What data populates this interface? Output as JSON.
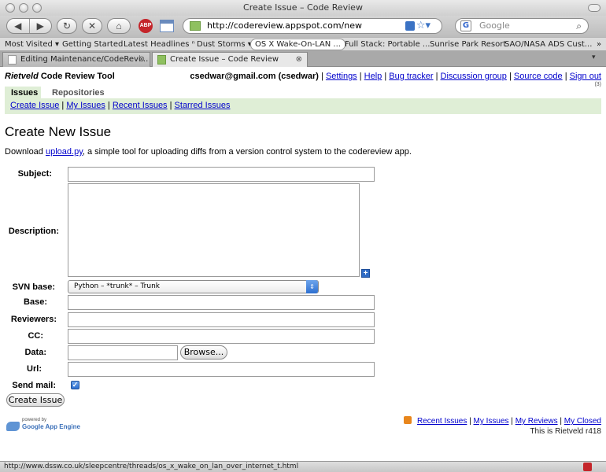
{
  "window": {
    "title": "Create Issue – Code Review"
  },
  "toolbar": {
    "url": "http://codereview.appspot.com/new",
    "search_placeholder": "Google"
  },
  "bookmarks": [
    "Most Visited ▾",
    "Getting Started",
    "Latest Headlines ⁿ",
    "Dust Storms ▾",
    "OS X Wake-On-LAN ...",
    "Full Stack: Portable ...",
    "Sunrise Park Resort",
    "SAO/NASA ADS Cust...",
    "»"
  ],
  "tabs": [
    {
      "label": "Editing Maintenance/CodeRevi..."
    },
    {
      "label": "Create Issue – Code Review"
    }
  ],
  "header": {
    "brand_italic": "Rietveld",
    "brand_rest": " Code Review Tool",
    "user": "csedwar@gmail.com (csedwar)",
    "links": [
      "Settings",
      "Help",
      "Bug tracker",
      "Discussion group",
      "Source code",
      "Sign out"
    ],
    "counter": "(3)"
  },
  "nav": {
    "tabs": [
      "Issues",
      "Repositories"
    ],
    "sublinks": [
      "Create Issue",
      "My Issues",
      "Recent Issues",
      "Starred Issues"
    ]
  },
  "main": {
    "title": "Create New Issue",
    "intro_before": "Download ",
    "intro_link": "upload.py",
    "intro_after": ", a simple tool for uploading diffs from a version control system to the codereview app."
  },
  "form": {
    "subject_label": "Subject:",
    "description_label": "Description:",
    "svn_label": "SVN base:",
    "svn_value": "Python – *trunk* – Trunk",
    "base_label": "Base:",
    "reviewers_label": "Reviewers:",
    "cc_label": "CC:",
    "data_label": "Data:",
    "browse_label": "Browse...",
    "url_label": "Url:",
    "sendmail_label": "Send mail:",
    "submit_label": "Create Issue"
  },
  "footer": {
    "powered_small": "powered by",
    "powered_name": "Google App Engine",
    "links": [
      "Recent Issues",
      "My Issues",
      "My Reviews",
      "My Closed"
    ],
    "version": "This is Rietveld r418"
  },
  "statusbar": {
    "text": "http://www.dssw.co.uk/sleepcentre/threads/os_x_wake_on_lan_over_internet_t.html"
  }
}
